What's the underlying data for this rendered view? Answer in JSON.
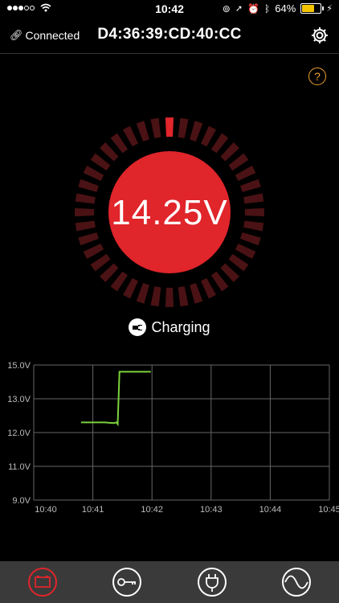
{
  "status_bar": {
    "time": "10:42",
    "battery_percent": "64%"
  },
  "header": {
    "connection_label": "Connected",
    "device_address": "D4:36:39:CD:40:CC"
  },
  "help": {
    "label": "?"
  },
  "gauge": {
    "voltage": "14.25V",
    "state": "Charging",
    "active_segment": 0,
    "segment_count": 40,
    "color_active": "#e0252b",
    "color_inactive": "#4a1214",
    "color_circle": "#e0252b"
  },
  "chart_data": {
    "type": "line",
    "ylabels": [
      "15.0V",
      "13.0V",
      "12.0V",
      "11.0V",
      "9.0V"
    ],
    "xlabels": [
      "10:40",
      "10:41",
      "10:42",
      "10:43",
      "10:44",
      "10:45"
    ],
    "series": [
      {
        "color": "#7bd13c",
        "points": [
          [
            "10:40.8",
            12.3
          ],
          [
            "10:41.2",
            12.3
          ],
          [
            "10:41.35",
            12.28
          ],
          [
            "10:41.4",
            12.3
          ],
          [
            "10:41.42",
            12.25
          ],
          [
            "10:41.45",
            14.6
          ],
          [
            "10:41.98",
            14.6
          ]
        ]
      }
    ]
  },
  "tabs": [
    {
      "icon": "battery-icon",
      "active": true
    },
    {
      "icon": "key-icon",
      "active": false
    },
    {
      "icon": "plug-icon",
      "active": false
    },
    {
      "icon": "waveform-icon",
      "active": false
    }
  ]
}
